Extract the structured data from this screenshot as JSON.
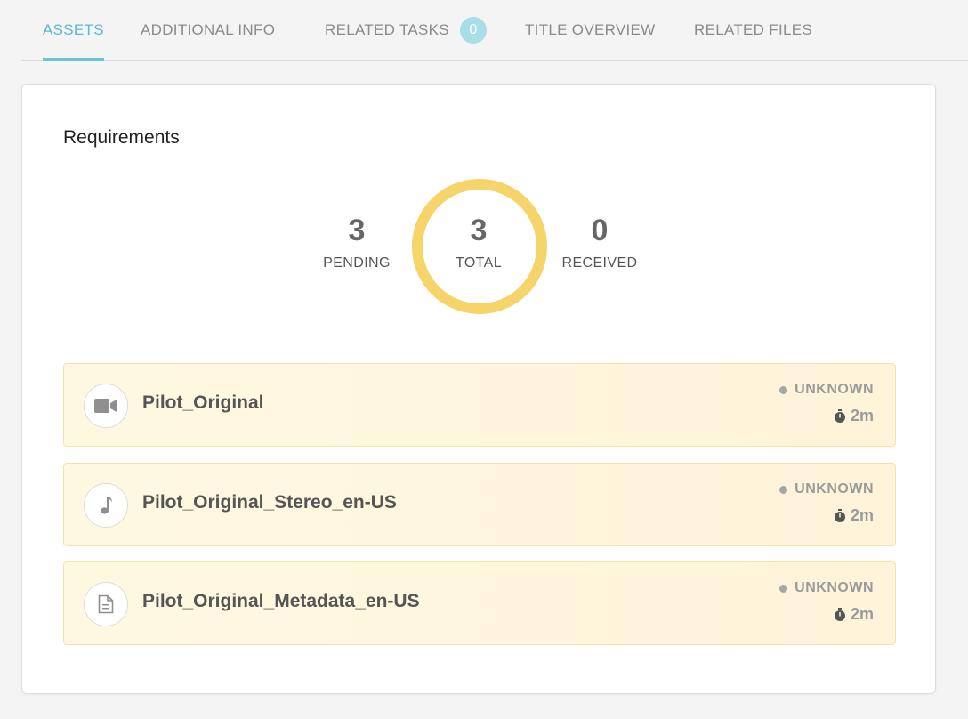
{
  "tabs": [
    {
      "label": "ASSETS",
      "active": true
    },
    {
      "label": "ADDITIONAL INFO",
      "active": false
    },
    {
      "label": "RELATED TASKS",
      "badge": "0",
      "active": false
    },
    {
      "label": "TITLE OVERVIEW",
      "active": false
    },
    {
      "label": "RELATED FILES",
      "active": false
    }
  ],
  "requirements": {
    "title": "Requirements",
    "pending": {
      "value": "3",
      "label": "PENDING"
    },
    "total": {
      "value": "3",
      "label": "TOTAL"
    },
    "received": {
      "value": "0",
      "label": "RECEIVED"
    },
    "ring_color": "#f5d46a"
  },
  "assets": [
    {
      "name": "Pilot_Original",
      "icon": "video-camera-icon",
      "status": "UNKNOWN",
      "time": "2m"
    },
    {
      "name": "Pilot_Original_Stereo_en-US",
      "icon": "music-note-icon",
      "status": "UNKNOWN",
      "time": "2m"
    },
    {
      "name": "Pilot_Original_Metadata_en-US",
      "icon": "document-icon",
      "status": "UNKNOWN",
      "time": "2m"
    }
  ],
  "colors": {
    "accent": "#6cc3d6",
    "asset_background": "#fff8e1",
    "asset_border": "#f4e3a6"
  }
}
